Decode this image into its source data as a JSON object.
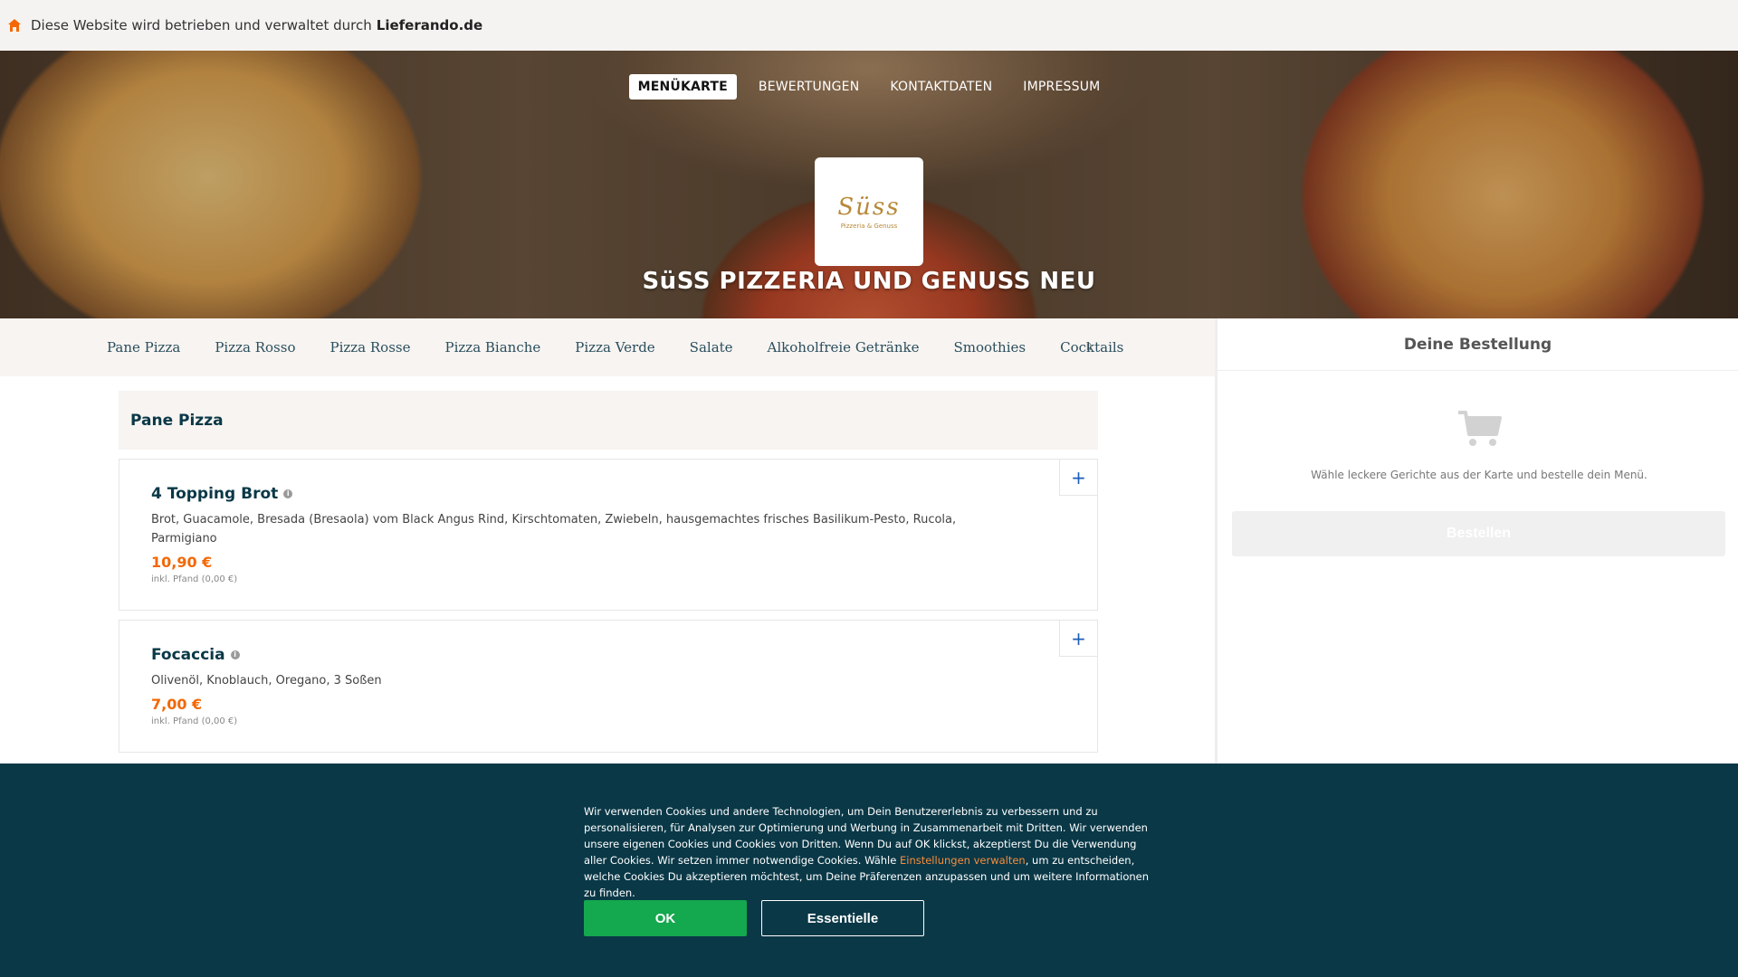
{
  "topbar": {
    "text": "Diese Website wird betrieben und verwaltet durch",
    "brand": "Lieferando.de"
  },
  "nav": {
    "items": [
      "MENÜKARTE",
      "BEWERTUNGEN",
      "KONTAKTDATEN",
      "IMPRESSUM"
    ],
    "active": "MENÜKARTE"
  },
  "hero": {
    "logo_script": "Süss",
    "logo_sub": "Pizzeria & Genuss",
    "restaurant_name": "SüSS PIZZERIA UND GENUSS NEU"
  },
  "categories": [
    "Pane Pizza",
    "Pizza Rosso",
    "Pizza Rosse",
    "Pizza Bianche",
    "Pizza Verde",
    "Salate",
    "Alkoholfreie Getränke",
    "Smoothies",
    "Cocktails"
  ],
  "icons": {
    "more": "chevron-icon",
    "cart": "cart-icon",
    "home": "home-icon",
    "info": "info-icon"
  },
  "sidebar": {
    "title": "Deine Bestellung",
    "empty_text": "Wähle leckere Gerichte aus der Karte und bestelle dein Menü.",
    "order_button": "Bestellen"
  },
  "menu": {
    "section_title": "Pane Pizza",
    "dishes": [
      {
        "name": "4 Topping Brot",
        "description": "Brot, Guacamole, Bresada (Bresaola) vom Black Angus Rind, Kirschtomaten, Zwiebeln, hausgemachtes frisches Basilikum-Pesto, Rucola, Parmigiano",
        "price": "10,90 €",
        "pfand": "inkl. Pfand (0,00 €)",
        "add": "+"
      },
      {
        "name": "Focaccia",
        "description": "Olivenöl, Knoblauch, Oregano, 3 Soßen",
        "price": "7,00 €",
        "pfand": "inkl. Pfand (0,00 €)",
        "add": "+"
      }
    ]
  },
  "cookie": {
    "text_before": "Wir verwenden Cookies und andere Technologien, um Dein Benutzererlebnis zu verbessern und zu personalisieren, für Analysen zur Optimierung und Werbung in Zusammenarbeit mit Dritten. Wir verwenden unsere eigenen Cookies und Cookies von Dritten. Wenn Du auf OK klickst, akzeptierst Du die Verwendung aller Cookies. Wir setzen immer notwendige Cookies. Wähle ",
    "link": "Einstellungen verwalten",
    "text_after": ", um zu entscheiden, welche Cookies Du akzeptieren möchtest, um Deine Präferenzen anzupassen und um weitere Informationen zu finden.",
    "ok_button": "OK",
    "essential_button": "Essentielle"
  },
  "colors": {
    "price": "#f36805",
    "cookie_bg": "#0a3847",
    "ok_green": "#14a84f",
    "link_orange": "#f78d3c",
    "add_blue": "#1c5fb8"
  }
}
